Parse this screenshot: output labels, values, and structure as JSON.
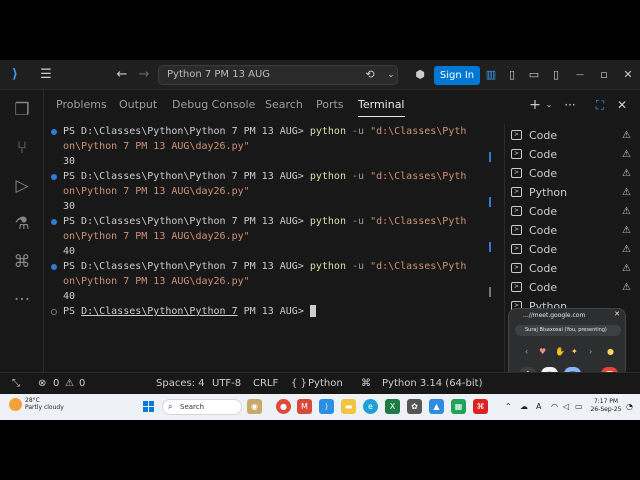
{
  "titlebar": {
    "search_text": "Python 7 PM 13 AUG",
    "signin_label": "Sign In",
    "minimize_glyph": "—",
    "restore_glyph": "▫",
    "close_glyph": "✕"
  },
  "panel": {
    "tabs": [
      "Problems",
      "Output",
      "Debug Console",
      "Search",
      "Ports",
      "Terminal"
    ],
    "active_tab": "Terminal"
  },
  "terminal": {
    "runs": [
      {
        "prompt": "PS D:\\Classes\\Python\\Python 7 PM 13 AUG> ",
        "cmd": "python",
        "flag": " -u ",
        "arg1": "\"d:\\Classes\\Pyth",
        "arg2": "on\\Python 7 PM 13 AUG\\day26.py\"",
        "output": "30"
      },
      {
        "prompt": "PS D:\\Classes\\Python\\Python 7 PM 13 AUG> ",
        "cmd": "python",
        "flag": " -u ",
        "arg1": "\"d:\\Classes\\Pyth",
        "arg2": "on\\Python 7 PM 13 AUG\\day26.py\"",
        "output": "30"
      },
      {
        "prompt": "PS D:\\Classes\\Python\\Python 7 PM 13 AUG> ",
        "cmd": "python",
        "flag": " -u ",
        "arg1": "\"d:\\Classes\\Pyth",
        "arg2": "on\\Python 7 PM 13 AUG\\day26.py\"",
        "output": "40"
      },
      {
        "prompt": "PS D:\\Classes\\Python\\Python 7 PM 13 AUG> ",
        "cmd": "python",
        "flag": " -u ",
        "arg1": "\"d:\\Classes\\Pyth",
        "arg2": "on\\Python 7 PM 13 AUG\\day26.py\"",
        "output": "40"
      }
    ],
    "final_prompt_prefix": "PS ",
    "final_prompt_path": "D:\\Classes\\Python\\Python 7",
    "final_prompt_suffix": " PM 13 AUG> "
  },
  "terminal_list": [
    {
      "name": "Code"
    },
    {
      "name": "Code"
    },
    {
      "name": "Code"
    },
    {
      "name": "Python"
    },
    {
      "name": "Code"
    },
    {
      "name": "Code"
    },
    {
      "name": "Code"
    },
    {
      "name": "Code"
    },
    {
      "name": "Code"
    },
    {
      "name": "Python"
    }
  ],
  "meet": {
    "url": "...//meet.google.com",
    "presenter": "Suraj Bisaxosai (You, presenting)"
  },
  "statusbar": {
    "errors": "0",
    "warnings": "0",
    "spaces": "Spaces: 4",
    "encoding": "UTF-8",
    "eol": "CRLF",
    "language": "Python",
    "interpreter": "Python 3.14 (64-bit)"
  },
  "taskbar": {
    "weather_temp": "28°C",
    "weather_desc": "Partly cloudy",
    "search_label": "Search",
    "time": "7:17 PM",
    "date": "26-Sep-25"
  },
  "colors": {
    "accent": "#0078d4",
    "terminal_bg": "#181818",
    "decoration": "#2f7bd6"
  }
}
